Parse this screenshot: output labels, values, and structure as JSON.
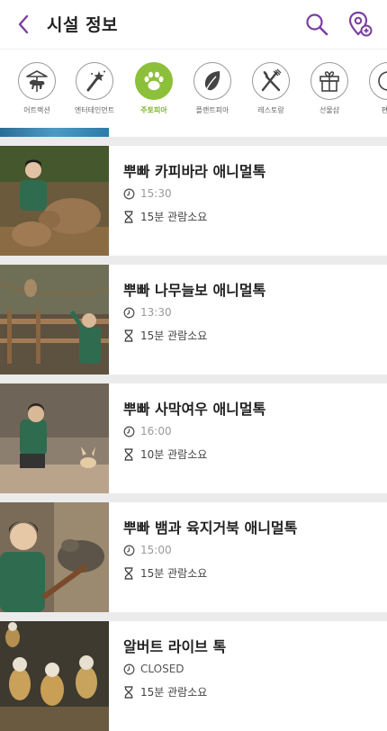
{
  "header": {
    "title": "시설 정보",
    "accent": "#7b3fa0"
  },
  "categories": [
    {
      "label": "어트랙션",
      "icon": "carousel-horse-icon",
      "active": false
    },
    {
      "label": "엔터테인먼트",
      "icon": "magic-wand-icon",
      "active": false
    },
    {
      "label": "주토피아",
      "icon": "paw-icon",
      "active": true
    },
    {
      "label": "플랜트피아",
      "icon": "leaf-icon",
      "active": false
    },
    {
      "label": "레스토랑",
      "icon": "fork-knife-icon",
      "active": false
    },
    {
      "label": "선물샵",
      "icon": "gift-icon",
      "active": false
    },
    {
      "label": "편의",
      "icon": "info-icon",
      "active": false
    }
  ],
  "active_color": "#8dc03a",
  "items": [
    {
      "title": "뿌빠 카피바라 애니멀톡",
      "time": "15:30",
      "duration": "15분 관람소요"
    },
    {
      "title": "뿌빠 나무늘보 애니멀톡",
      "time": "13:30",
      "duration": "15분 관람소요"
    },
    {
      "title": "뿌빠 사막여우 애니멀톡",
      "time": "16:00",
      "duration": "10분 관람소요"
    },
    {
      "title": "뿌빠 뱀과 육지거북 애니멀톡",
      "time": "15:00",
      "duration": "15분 관람소요"
    },
    {
      "title": "알버트 라이브 톡",
      "time": "CLOSED",
      "duration": "15분 관람소요"
    }
  ]
}
